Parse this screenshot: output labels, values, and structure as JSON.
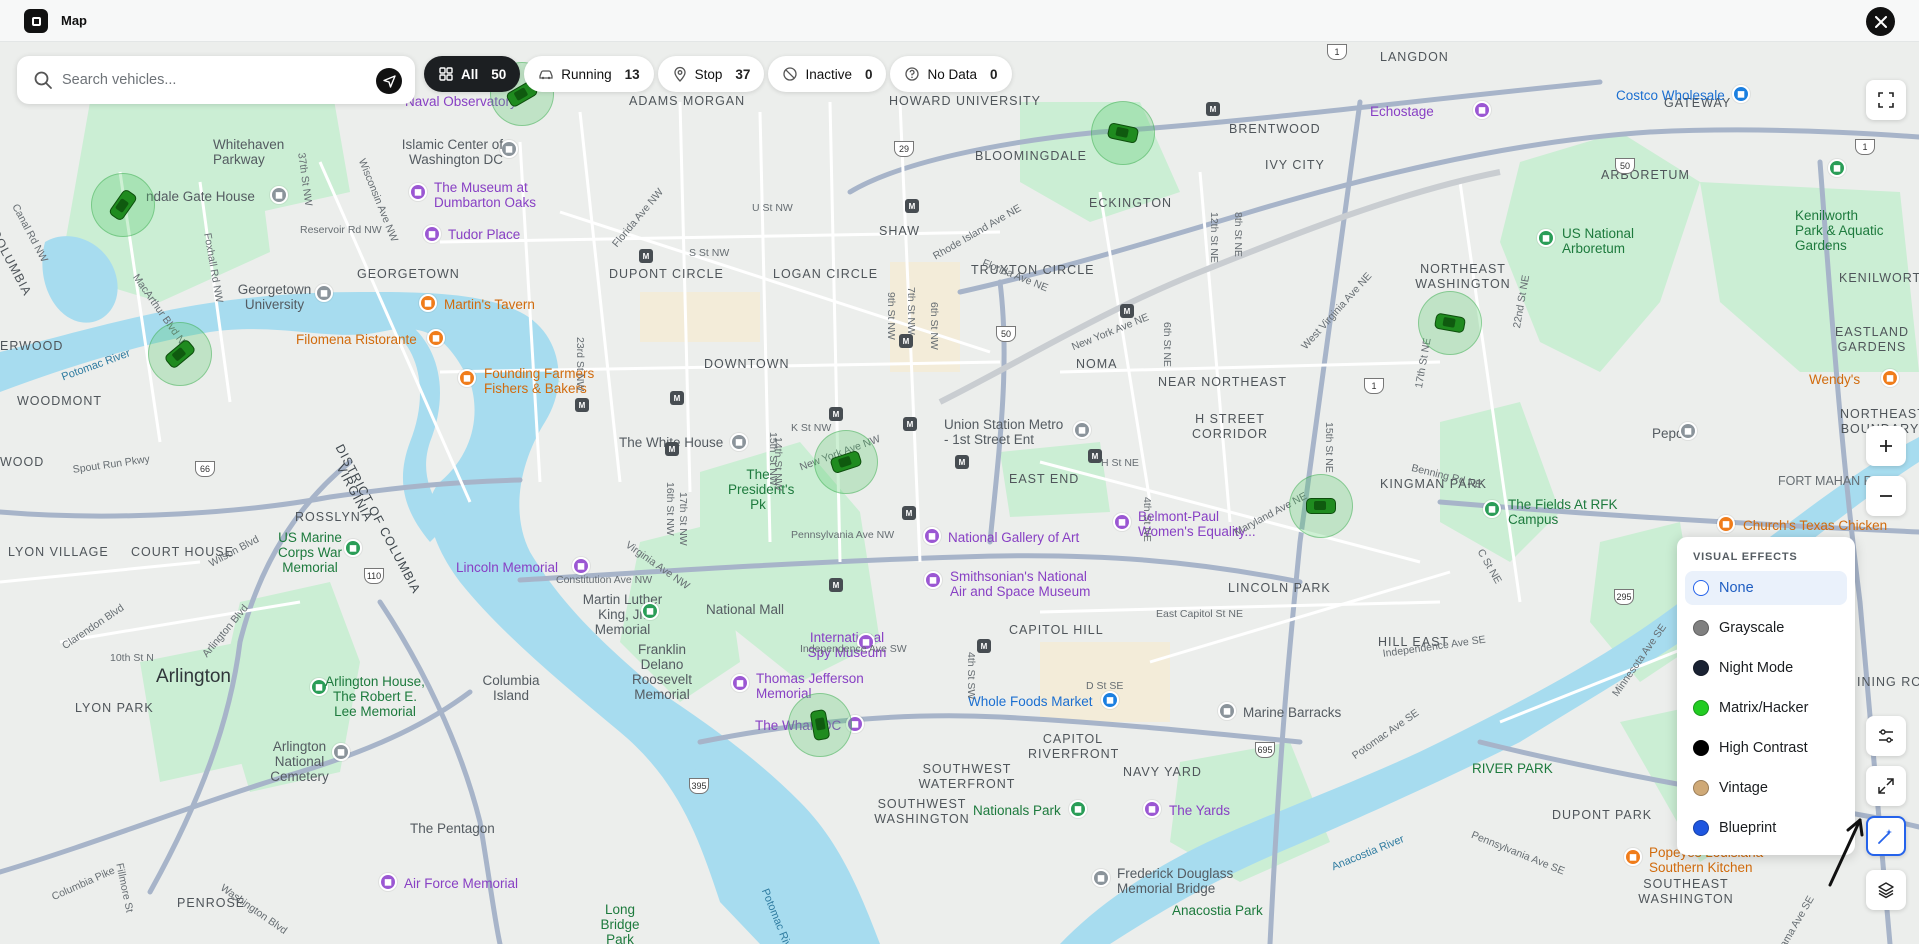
{
  "header": {
    "title": "Map",
    "close_icon": "close-icon"
  },
  "search": {
    "placeholder": "Search vehicles..."
  },
  "filters": [
    {
      "label": "All",
      "count": "50",
      "icon": "grid-icon",
      "active": true
    },
    {
      "label": "Running",
      "count": "13",
      "icon": "car-icon"
    },
    {
      "label": "Stop",
      "count": "37",
      "icon": "map-pin-icon"
    },
    {
      "label": "Inactive",
      "count": "0",
      "icon": "inactive-icon"
    },
    {
      "label": "No Data",
      "count": "0",
      "icon": "help-circle-icon"
    }
  ],
  "visual_effects": {
    "title": "VISUAL EFFECTS",
    "selected": "None",
    "options": [
      {
        "label": "None",
        "color": "#ffffff"
      },
      {
        "label": "Grayscale",
        "color": "#808080"
      },
      {
        "label": "Night Mode",
        "color": "#1a2233"
      },
      {
        "label": "Matrix/Hacker",
        "color": "#22cc22"
      },
      {
        "label": "High Contrast",
        "color": "#000000"
      },
      {
        "label": "Vintage",
        "color": "#cfa977"
      },
      {
        "label": "Blueprint",
        "color": "#1e56e0"
      }
    ]
  },
  "map_labels": {
    "neighborhoods": [
      "ADAMS MORGAN",
      "HOWARD UNIVERSITY",
      "LANGDON",
      "GATEWAY",
      "BRENTWOOD",
      "ARBORETUM",
      "BLOOMINGDALE",
      "IVY CITY",
      "ECKINGTON",
      "SHAW",
      "DUPONT CIRCLE",
      "LOGAN CIRCLE",
      "TRUXTON CIRCLE",
      "NORTHEAST WASHINGTON",
      "GEORGETOWN",
      "DOWNTOWN",
      "NOMA",
      "NEAR NORTHEAST",
      "H STREET CORRIDOR",
      "WOODMONT",
      "ROSSLYN",
      "EAST END",
      "KINGMAN PARK",
      "LYON VILLAGE",
      "COURT HOUSE",
      "LINCOLN PARK",
      "CAPITOL HILL",
      "HILL EAST",
      "LYON PARK",
      "CAPITOL RIVERFRONT",
      "NAVY YARD",
      "SOUTHWEST WATERFRONT",
      "SOUTHWEST WASHINGTON",
      "DUPONT PARK",
      "SOUTHEAST WASHINGTON",
      "PENROSE",
      "EASTLAND GARDENS",
      "KENILWORTH",
      "NORTHEAST BOUNDARY",
      "FORT MAHAN PARK",
      "DISTRICT OF COLUMBIA",
      "VIRGINIA",
      "ERWOOD",
      "WOOD",
      "COLUMBIA",
      "RIVER PARK",
      "INING ROC"
    ],
    "city": "Arlington",
    "pois": {
      "naval_observatory": "Naval Observatory",
      "whitehaven_parkway": "Whitehaven Parkway",
      "islamic_center": "Islamic Center of Washington DC",
      "museum_dumbarton": "The Museum at Dumbarton Oaks",
      "tudor_place": "Tudor Place",
      "glover_house": "Glover Archbold / Vandale Gate House",
      "georgetown_univ": "Georgetown University",
      "martins_tavern": "Martin's Tavern",
      "filomena": "Filomena Ristorante",
      "founding_farmers": "Founding Farmers Fishers & Bakers",
      "white_house": "The White House",
      "presidents_park": "The President's Pk",
      "union_station": "Union Station Metro - 1st Street Ent",
      "national_gallery": "National Gallery of Art",
      "smithsonian_air": "Smithsonian's National Air and Space Museum",
      "belmont_paul": "Belmont-Paul Women's Equality...",
      "us_marine": "US Marine Corps War Memorial",
      "lincoln_memorial": "Lincoln Memorial",
      "mlk_memorial": "Martin Luther King, Jr. Memorial",
      "national_mall": "National Mall",
      "spy_museum": "International Spy Museum",
      "fdr_memorial": "Franklin Delano Roosevelt Memorial",
      "jefferson_memorial": "Thomas Jefferson Memorial",
      "the_wharf": "The Wharf DC",
      "whole_foods": "Whole Foods Market",
      "marine_barracks": "Marine Barracks",
      "nationals_park": "Nationals Park",
      "the_yards": "The Yards",
      "arlington_house": "Arlington House, The Robert E. Lee Memorial",
      "arlington_cemetery": "Arlington National Cemetery",
      "columbia_island": "Columbia Island",
      "pentagon": "The Pentagon",
      "air_force_memorial": "Air Force Memorial",
      "long_bridge_park": "Long Bridge Park",
      "frederick_douglass": "Frederick Douglass Memorial Bridge",
      "anacostia_park": "Anacostia Park",
      "costco": "Costco Wholesale",
      "echostage": "Echostage",
      "us_arboretum": "US National Arboretum",
      "kenilworth_gardens": "Kenilworth Park & Aquatic Gardens",
      "wendys": "Wendy's",
      "pepco": "Pepco",
      "fields_rfk": "The Fields At RFK Campus",
      "churchs": "Church's Texas Chicken",
      "popeyes": "Popeyes Louisiana Southern Kitchen"
    },
    "streets": [
      "Reservoir Rd NW",
      "MacArthur Blvd NW",
      "Foxhall Rd NW",
      "37th St NW",
      "Wisconsin Ave NW",
      "Florida Ave NW",
      "U St NW",
      "S St NW",
      "Rhode Island Ave NE",
      "Florida Ave NE",
      "New York Ave NE",
      "West Virginia Ave NE",
      "K St NW",
      "New York Ave NW",
      "H St NE",
      "Maryland Ave NE",
      "Benning Rd NE",
      "Constitution Ave NW",
      "Pennsylvania Ave NW",
      "Virginia Ave NW",
      "Independence Ave SW",
      "D St SE",
      "East Capitol St NE",
      "Independence Ave SE",
      "Potomac Ave SE",
      "Pennsylvania Ave SE",
      "Minnesota Ave SE",
      "Washington Blvd",
      "Columbia Pike",
      "Spout Run Pkwy",
      "Wilson Blvd",
      "Clarendon Blvd",
      "Arlington Blvd",
      "Fillmore St",
      "10th St N",
      "Canal Rd NW",
      "16th St NW",
      "14th St NW",
      "9th St NW",
      "7th St NW",
      "6th St NW",
      "4th St NW",
      "4th St SW",
      "23rd St NW",
      "17th St NW",
      "15th St NW",
      "12th St NE",
      "8th St NE",
      "9th St NE",
      "6th St NE",
      "4th St NE",
      "15th St NE",
      "17th St NE",
      "22nd St NE",
      "Alabama Ave SE",
      "C St NE"
    ],
    "water": [
      "Potomac River",
      "Anacostia River",
      "Potomac River"
    ],
    "route_numbers": [
      "1",
      "29",
      "50",
      "66",
      "110",
      "395",
      "695",
      "295",
      "1",
      "50",
      "1"
    ]
  },
  "vehicles": [
    {
      "status": "stop"
    },
    {
      "status": "stop"
    },
    {
      "status": "stop"
    },
    {
      "status": "stop"
    },
    {
      "status": "stop"
    },
    {
      "status": "stop"
    },
    {
      "status": "stop"
    },
    {
      "status": "stop"
    }
  ]
}
